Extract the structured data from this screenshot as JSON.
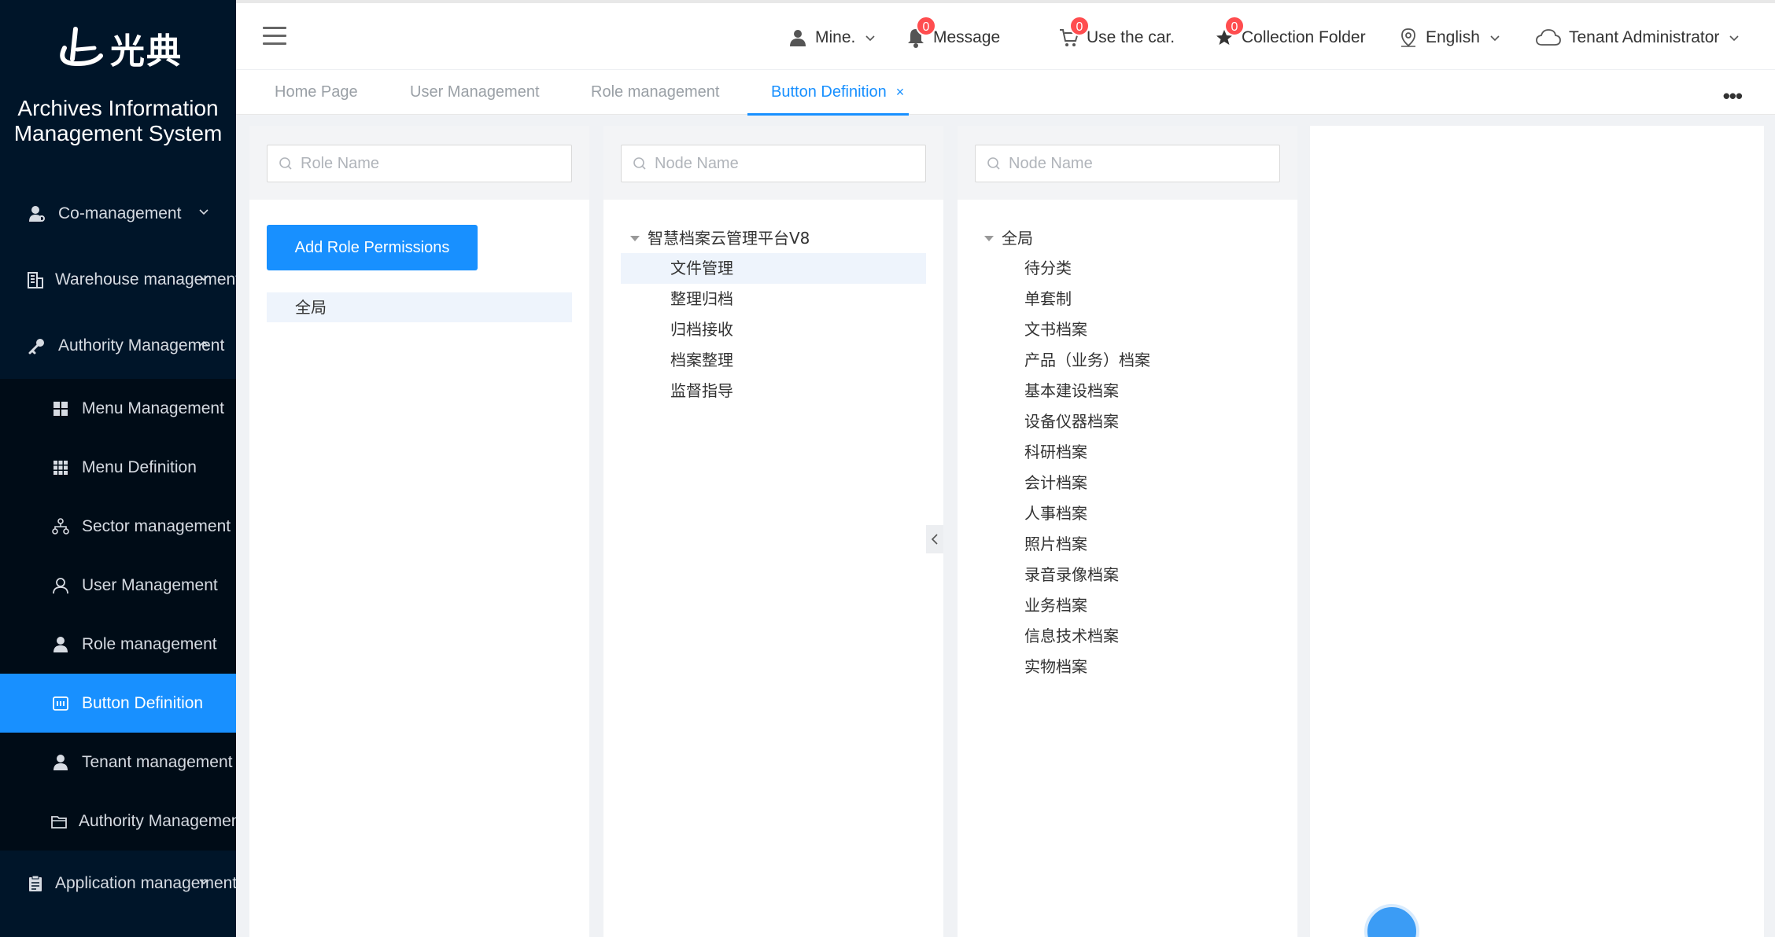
{
  "brand": {
    "logo_text": "光典",
    "system_title_line1": "Archives Information",
    "system_title_line2": "Management System"
  },
  "sidebar": {
    "top_items": [
      {
        "label": "Co-management",
        "icon": "user-cog-icon"
      },
      {
        "label": "Warehouse management",
        "icon": "building-icon"
      },
      {
        "label": "Authority Management",
        "icon": "key-icon"
      }
    ],
    "sub_items": [
      {
        "label": "Menu Management",
        "icon": "grid-icon"
      },
      {
        "label": "Menu Definition",
        "icon": "grid-dots-icon"
      },
      {
        "label": "Sector management",
        "icon": "org-chart-icon"
      },
      {
        "label": "User Management",
        "icon": "user-outline-icon"
      },
      {
        "label": "Role management",
        "icon": "user-filled-icon"
      },
      {
        "label": "Button Definition",
        "icon": "button-icon",
        "active": true
      },
      {
        "label": "Tenant management",
        "icon": "user-filled-icon"
      },
      {
        "label": "Authority Management",
        "icon": "folder-icon"
      }
    ],
    "bottom_items": [
      {
        "label": "Application management",
        "icon": "clipboard-icon"
      }
    ]
  },
  "header": {
    "mine_label": "Mine.",
    "message_label": "Message",
    "message_count": "0",
    "car_label": "Use the car.",
    "car_count": "0",
    "collection_label": "Collection Folder",
    "collection_count": "0",
    "language_label": "English",
    "user_label": "Tenant Administrator"
  },
  "tabs": [
    {
      "label": "Home Page"
    },
    {
      "label": "User Management"
    },
    {
      "label": "Role management"
    },
    {
      "label": "Button Definition",
      "active": true,
      "close": "×"
    }
  ],
  "panel_role": {
    "search_placeholder": "Role Name",
    "add_button_label": "Add Role Permissions",
    "roles": [
      "全局"
    ]
  },
  "panel_nodes": {
    "search_placeholder": "Node Name",
    "root": "智慧档案云管理平台V8",
    "children": [
      "文件管理",
      "整理归档",
      "归档接收",
      "档案整理",
      "监督指导"
    ],
    "selected_index": 0
  },
  "panel_nodes2": {
    "search_placeholder": "Node Name",
    "root": "全局",
    "children": [
      "待分类",
      "单套制",
      "文书档案",
      "产品（业务）档案",
      "基本建设档案",
      "设备仪器档案",
      "科研档案",
      "会计档案",
      "人事档案",
      "照片档案",
      "录音录像档案",
      "业务档案",
      "信息技术档案",
      "实物档案"
    ]
  },
  "colors": {
    "sidebar_bg": "#001529",
    "submenu_bg": "#000c17",
    "accent": "#1890ff",
    "badge": "#ff4d4f"
  }
}
